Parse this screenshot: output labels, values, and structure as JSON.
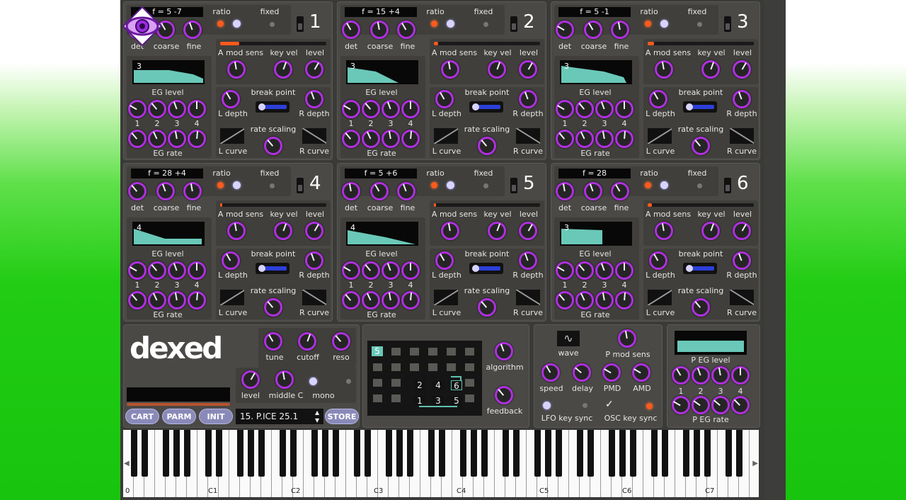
{
  "operators": [
    {
      "number": "1",
      "freq": "f = 5 -7",
      "eg": "3"
    },
    {
      "number": "2",
      "freq": "f = 15 +4",
      "eg": "3"
    },
    {
      "number": "3",
      "freq": "f = 5 -1",
      "eg": "3"
    },
    {
      "number": "4",
      "freq": "f = 28 +4",
      "eg": "4"
    },
    {
      "number": "5",
      "freq": "f = 5 +6",
      "eg": "4"
    },
    {
      "number": "6",
      "freq": "f = 28",
      "eg": "3"
    }
  ],
  "op_labels": {
    "ratio": "ratio",
    "fixed": "fixed",
    "det": "det",
    "coarse": "coarse",
    "fine": "fine",
    "a_mod_sens": "A mod sens",
    "key_vel": "key vel",
    "level": "level",
    "eg_level": "EG level",
    "eg_rate": "EG rate",
    "break_point": "break point",
    "l_depth": "L depth",
    "r_depth": "R depth",
    "rate_scaling": "rate scaling",
    "l_curve": "L curve",
    "r_curve": "R curve",
    "n1": "1",
    "n2": "2",
    "n3": "3",
    "n4": "4"
  },
  "global": {
    "logo": "dexed",
    "tune": "tune",
    "cutoff": "cutoff",
    "reso": "reso",
    "level": "level",
    "middle_c": "middle C",
    "mono": "mono",
    "cart": "CART",
    "parm": "PARM",
    "init": "INIT",
    "program": "15. P.ICE 25.1",
    "program_arrow": "▲▼",
    "store": "STORE"
  },
  "algorithm": {
    "number": "5",
    "label": "algorithm",
    "feedback": "feedback",
    "ops_top": [
      "2",
      "4",
      "6"
    ],
    "ops_bottom": [
      "1",
      "3",
      "5"
    ]
  },
  "lfo": {
    "wave": "wave",
    "p_mod_sens": "P mod sens",
    "speed": "speed",
    "delay": "delay",
    "pmd": "PMD",
    "amd": "AMD",
    "lfo_key_sync": "LFO key sync",
    "osc_key_sync": "OSC key sync",
    "check": "✓"
  },
  "pitch_eg": {
    "level": "P EG level",
    "rate": "P EG rate",
    "n1": "1",
    "n2": "2",
    "n3": "3",
    "n4": "4"
  },
  "keyboard": {
    "octaves": [
      "0",
      "C1",
      "C2",
      "C3",
      "C4",
      "C5",
      "C6",
      "C7"
    ],
    "left_arrow": "◀",
    "right_arrow": "▶"
  },
  "colors": {
    "accent": "#b030e0",
    "panel": "#4a4946",
    "eg_fill": "#6ac8b8",
    "led": "#ff5a1e"
  }
}
